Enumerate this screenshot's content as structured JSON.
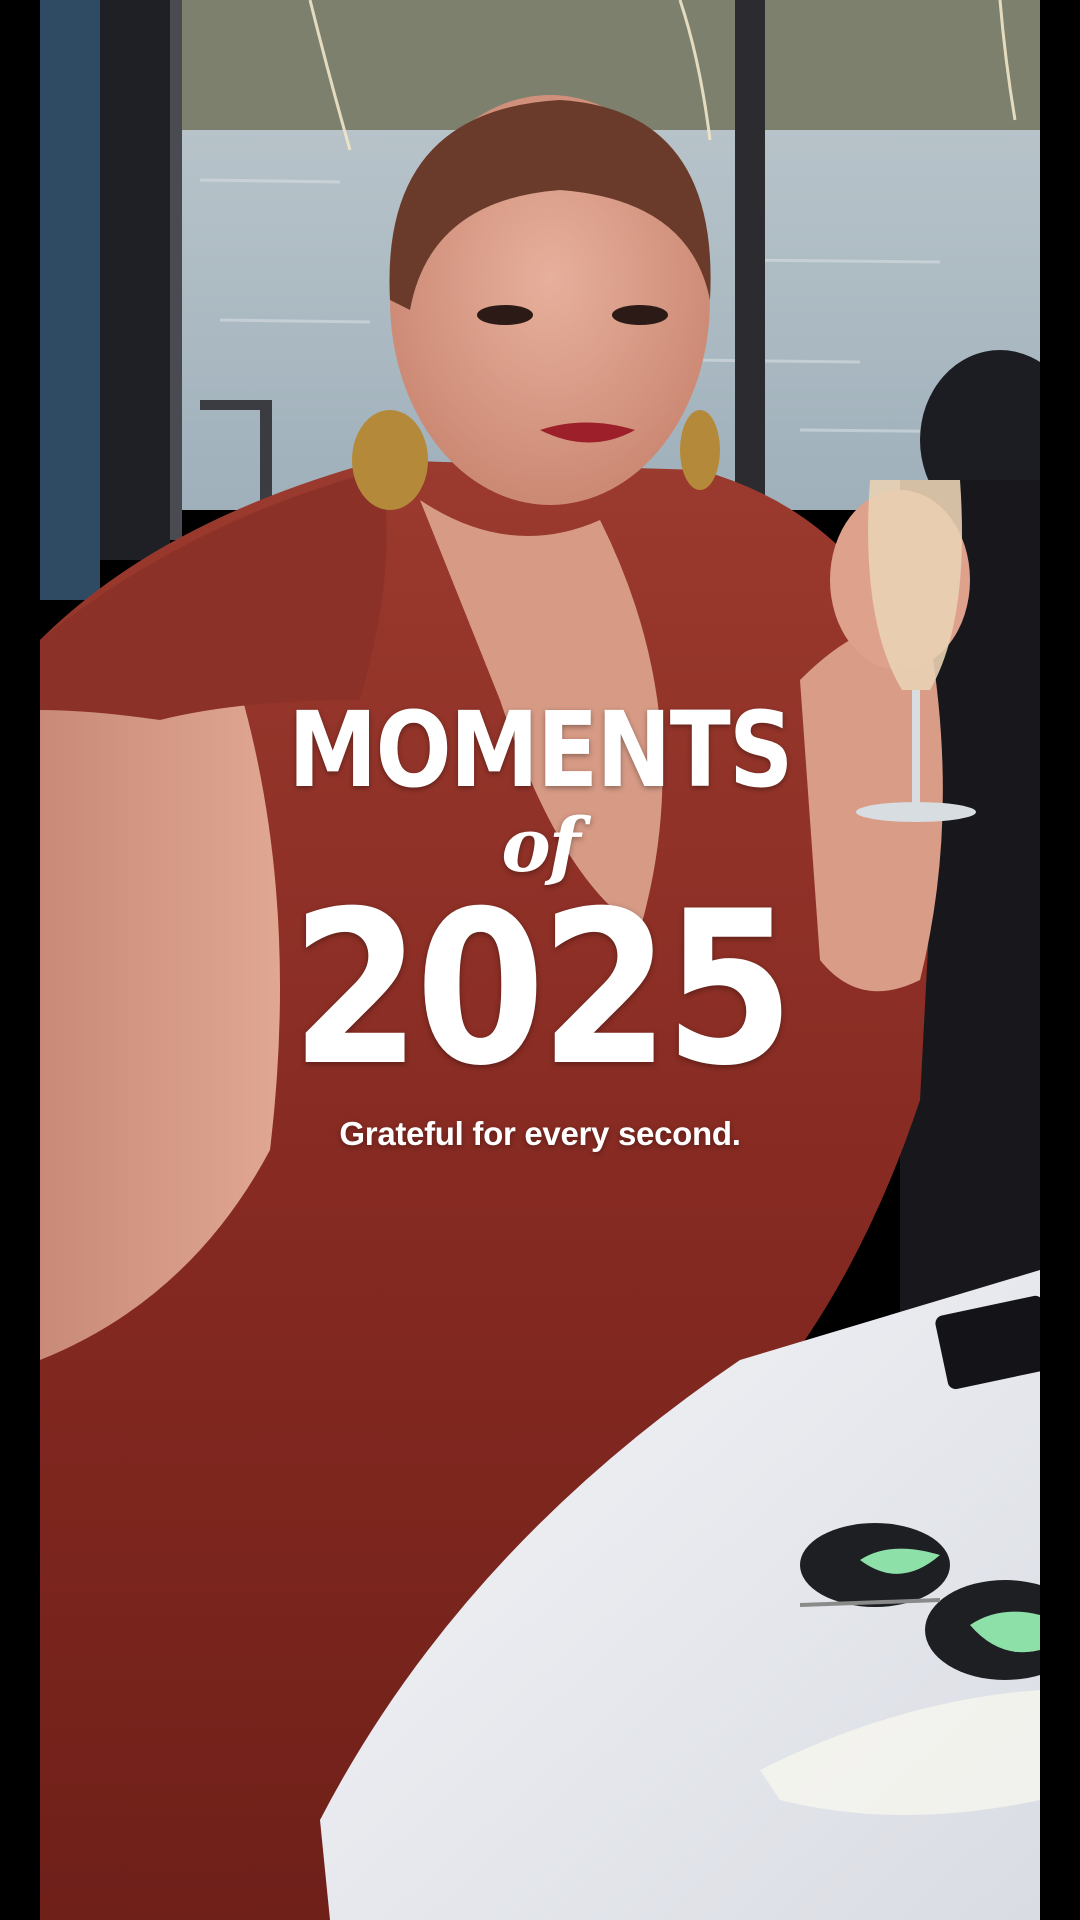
{
  "story": {
    "title_line1": "MOMENTS",
    "title_line2": "of",
    "title_line3": "2025",
    "subtitle": "Grateful for every second."
  },
  "colors": {
    "background": "#000000",
    "text": "#ffffff",
    "dress": "#8e2a22",
    "water": "#8fa3b0",
    "tablecloth": "#eef0f4"
  }
}
